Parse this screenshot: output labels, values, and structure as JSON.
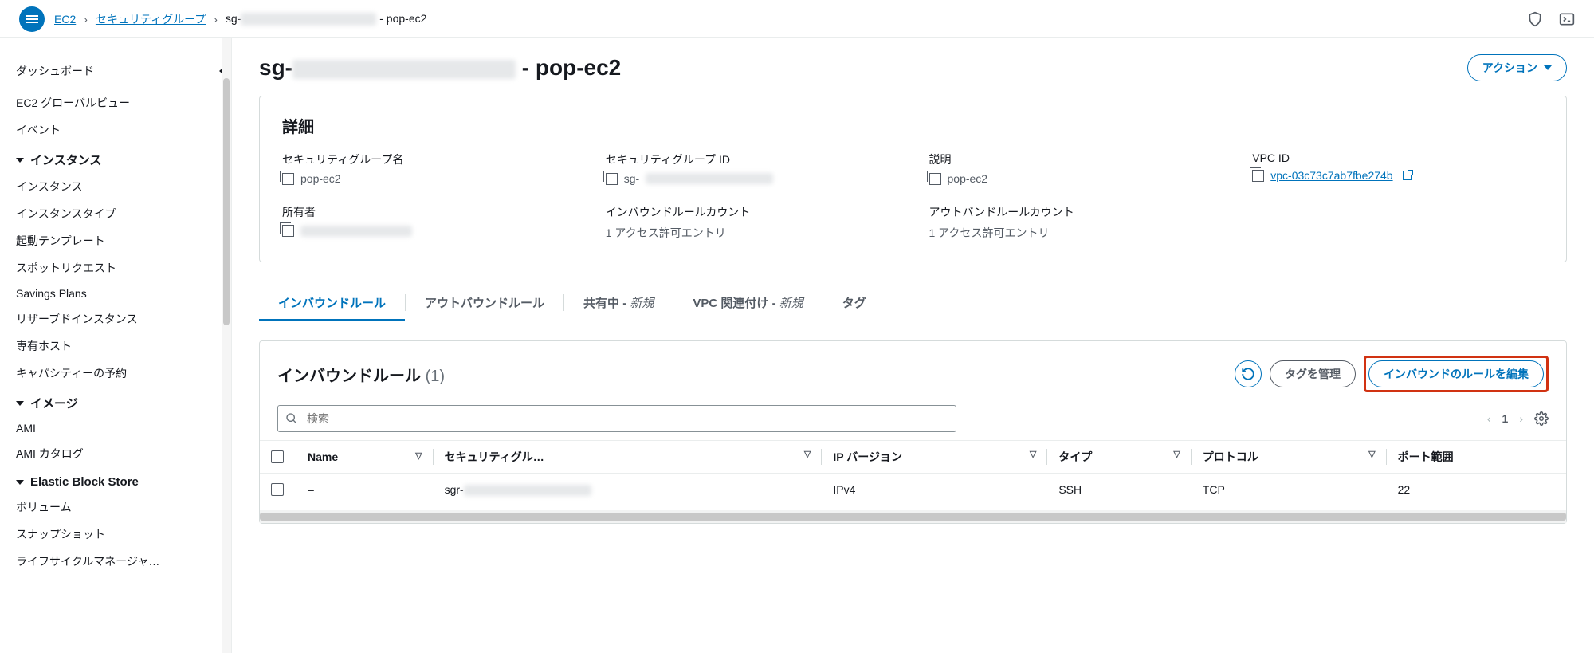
{
  "breadcrumb": {
    "root": "EC2",
    "l1": "セキュリティグループ",
    "sg_prefix": "sg-",
    "sg_suffix": " - pop-ec2"
  },
  "sidebar": {
    "top": [
      "ダッシュボード",
      "EC2 グローバルビュー",
      "イベント"
    ],
    "groups": [
      {
        "title": "インスタンス",
        "items": [
          "インスタンス",
          "インスタンスタイプ",
          "起動テンプレート",
          "スポットリクエスト",
          "Savings Plans",
          "リザーブドインスタンス",
          "専有ホスト",
          "キャパシティーの予約"
        ]
      },
      {
        "title": "イメージ",
        "items": [
          "AMI",
          "AMI カタログ"
        ]
      },
      {
        "title": "Elastic Block Store",
        "items": [
          "ボリューム",
          "スナップショット",
          "ライフサイクルマネージャ…"
        ]
      }
    ]
  },
  "page": {
    "title_prefix": "sg-",
    "title_suffix": " - pop-ec2",
    "action_label": "アクション"
  },
  "details": {
    "heading": "詳細",
    "fields": [
      {
        "label": "セキュリティグループ名",
        "value": "pop-ec2",
        "copy": true
      },
      {
        "label": "セキュリティグループ ID",
        "value": "sg-",
        "copy": true,
        "redact": true
      },
      {
        "label": "説明",
        "value": "pop-ec2",
        "copy": true
      },
      {
        "label": "VPC ID",
        "value": "vpc-03c73c7ab7fbe274b",
        "copy": true,
        "link": true
      },
      {
        "label": "所有者",
        "value": "",
        "copy": true,
        "redact": true
      },
      {
        "label": "インバウンドルールカウント",
        "value": "1 アクセス許可エントリ"
      },
      {
        "label": "アウトバンドルールカウント",
        "value": "1 アクセス許可エントリ"
      }
    ]
  },
  "tabs": [
    {
      "label": "インバウンドルール",
      "active": true
    },
    {
      "label": "アウトバウンドルール"
    },
    {
      "label": "共有中",
      "new": "新規"
    },
    {
      "label": "VPC 関連付け",
      "new": "新規"
    },
    {
      "label": "タグ"
    }
  ],
  "rules": {
    "title": "インバウンドルール",
    "count": "(1)",
    "manage_tags": "タグを管理",
    "edit": "インバウンドのルールを編集",
    "search_placeholder": "検索",
    "page": "1",
    "columns": [
      "Name",
      "セキュリティグル…",
      "IP バージョン",
      "タイプ",
      "プロトコル",
      "ポート範囲"
    ],
    "row": {
      "name": "–",
      "sgr": "sgr-",
      "ipver": "IPv4",
      "type": "SSH",
      "proto": "TCP",
      "port": "22"
    }
  }
}
